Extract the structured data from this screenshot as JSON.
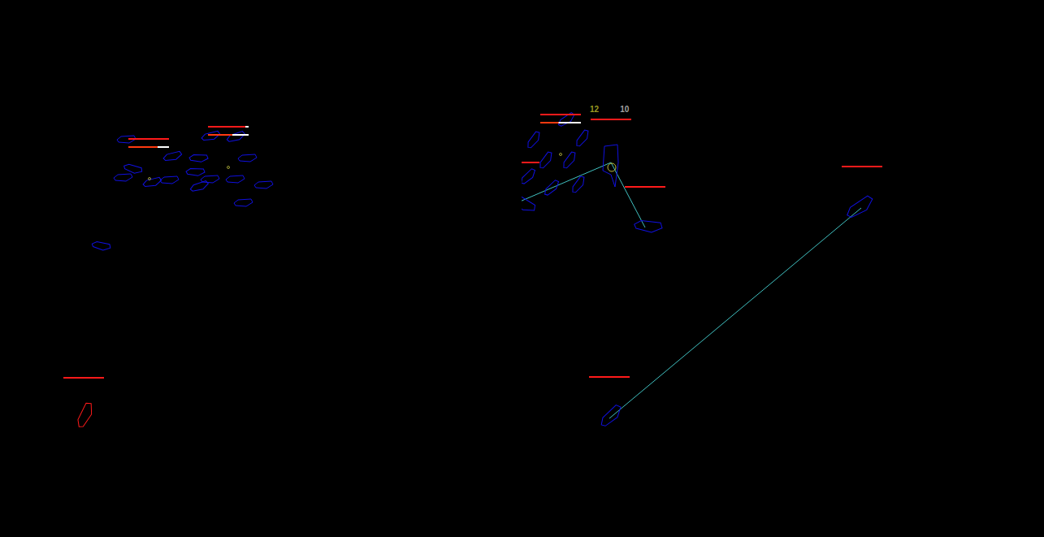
{
  "views": [
    {
      "name": "left-view",
      "units": [
        {
          "kind": "ship",
          "color": "#1010e0"
        },
        {
          "kind": "ship",
          "color": "#1010e0"
        },
        {
          "kind": "ship",
          "color": "#1010e0"
        },
        {
          "kind": "ship",
          "color": "#1010e0"
        },
        {
          "kind": "ship",
          "color": "#1010e0"
        },
        {
          "kind": "ship",
          "color": "#1010e0"
        },
        {
          "kind": "ship",
          "color": "#1010e0"
        },
        {
          "kind": "ship",
          "color": "#1010e0"
        },
        {
          "kind": "ship",
          "color": "#1010e0"
        },
        {
          "kind": "ship",
          "color": "#1010e0"
        },
        {
          "kind": "ship",
          "color": "#1010e0"
        },
        {
          "kind": "ship",
          "color": "#1010e0"
        },
        {
          "kind": "ship",
          "color": "#1010e0"
        },
        {
          "kind": "ship",
          "color": "#1010e0"
        },
        {
          "kind": "ship",
          "color": "#1010e0"
        },
        {
          "kind": "ship",
          "color": "#1010e0"
        },
        {
          "kind": "ship",
          "color": "#1010e0"
        },
        {
          "kind": "ship",
          "color": "#ff1a1a"
        }
      ],
      "health_bars": [
        {
          "level": 1,
          "color": "#ff1a1a"
        },
        {
          "level": 0.72,
          "color": "#ff3a10"
        },
        {
          "level": 0.92,
          "color": "#ff1a1a"
        },
        {
          "level": 0.6,
          "color": "#ff3a10"
        },
        {
          "level": 1,
          "color": "#ff1a1a"
        }
      ]
    },
    {
      "name": "right-view",
      "units": [
        {
          "kind": "ship",
          "color": "#1010e0"
        },
        {
          "kind": "ship",
          "color": "#1010e0"
        },
        {
          "kind": "ship",
          "color": "#1010e0"
        },
        {
          "kind": "ship",
          "color": "#1010e0"
        },
        {
          "kind": "ship",
          "color": "#1010e0"
        },
        {
          "kind": "ship",
          "color": "#1010e0"
        },
        {
          "kind": "ship",
          "color": "#1010e0"
        },
        {
          "kind": "ship",
          "color": "#1010e0"
        },
        {
          "kind": "ship",
          "color": "#1010e0"
        },
        {
          "kind": "ship",
          "color": "#1010e0"
        },
        {
          "kind": "ship",
          "color": "#1010e0"
        },
        {
          "kind": "ship",
          "color": "#1010e0"
        },
        {
          "kind": "structure",
          "color": "#1010e0"
        }
      ],
      "health_bars": [
        {
          "level": 1,
          "color": "#ff1a1a"
        },
        {
          "level": 0.45,
          "color": "#ff3a10"
        },
        {
          "level": 1,
          "color": "#ff1a1a"
        },
        {
          "level": 1,
          "color": "#ff1a1a"
        },
        {
          "level": 1,
          "color": "#ff1a1a"
        },
        {
          "level": 1,
          "color": "#ff1a1a"
        },
        {
          "level": 1,
          "color": "#ff1a1a"
        }
      ]
    }
  ],
  "counters": [
    {
      "text": "12",
      "color": "#9a9a20"
    },
    {
      "text": "10",
      "color": "#a0a0a0"
    }
  ]
}
